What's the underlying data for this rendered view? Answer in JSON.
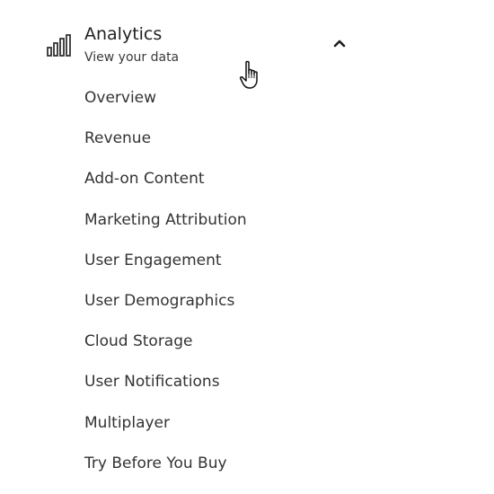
{
  "section": {
    "title": "Analytics",
    "subtitle": "View your data",
    "icon": "bar-chart-icon",
    "expanded_icon": "chevron-up-icon"
  },
  "menu": {
    "items": [
      {
        "label": "Overview"
      },
      {
        "label": "Revenue"
      },
      {
        "label": "Add-on Content"
      },
      {
        "label": "Marketing Attribution"
      },
      {
        "label": "User Engagement"
      },
      {
        "label": "User Demographics"
      },
      {
        "label": "Cloud Storage"
      },
      {
        "label": "User Notifications"
      },
      {
        "label": "Multiplayer"
      },
      {
        "label": "Try Before You Buy"
      }
    ]
  },
  "pointer": {
    "icon": "hand-pointer-icon"
  },
  "colors": {
    "text": "#333333",
    "heading": "#1f1f1f",
    "background": "#ffffff"
  }
}
